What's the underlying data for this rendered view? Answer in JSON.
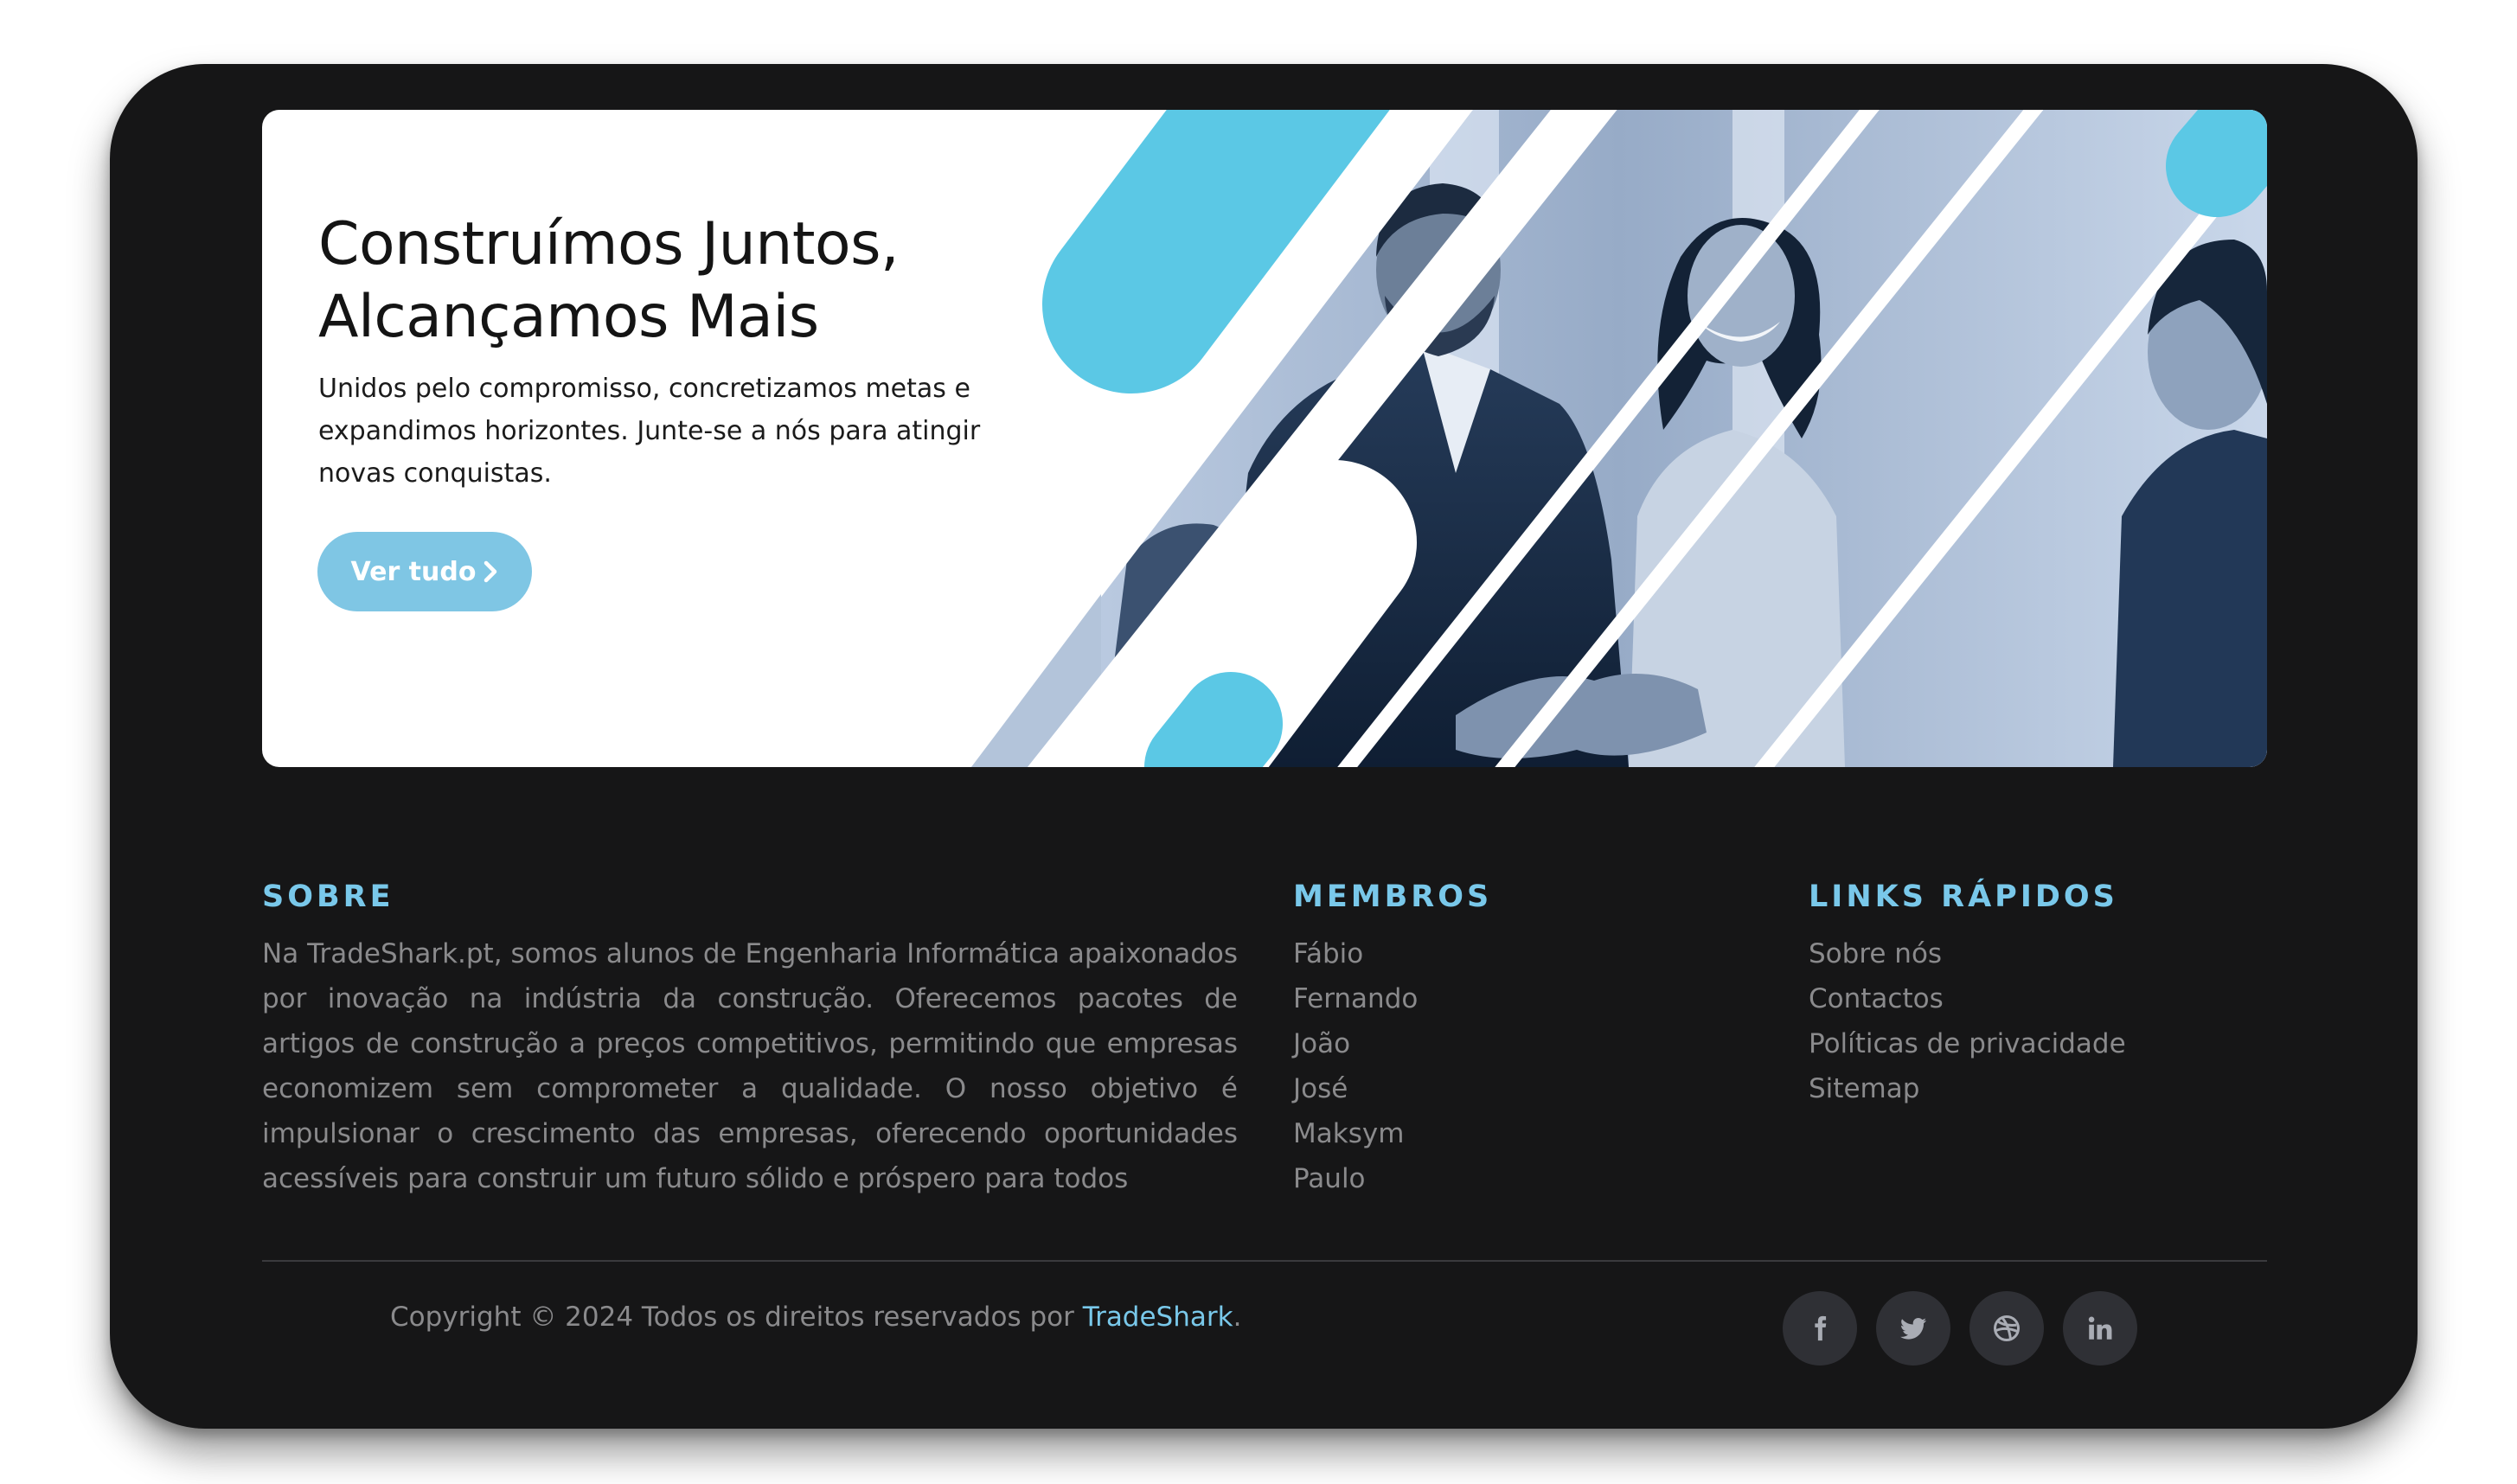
{
  "hero": {
    "title_line1": "Construímos Juntos,",
    "title_line2": "Alcançamos Mais",
    "description": "Unidos pelo compromisso, concretizamos metas e expandimos horizontes. Junte-se a nós para atingir novas conquistas.",
    "cta_label": "Ver tudo",
    "cta_icon": "chevron-right-icon",
    "accent_color": "#5bc8e5"
  },
  "footer": {
    "about": {
      "title": "SOBRE",
      "text": "Na TradeShark.pt, somos alunos de Engenharia Informática apaixonados por inovação na indústria da construção. Oferecemos pacotes de artigos de construção a preços competitivos, permitindo que empresas economizem sem comprometer a qualidade. O nosso objetivo é impulsionar o crescimento das empresas, oferecendo oportunidades acessíveis para construir um futuro sólido e próspero para todos"
    },
    "members": {
      "title": "MEMBROS",
      "items": [
        "Fábio",
        "Fernando",
        "João",
        "José",
        "Maksym",
        "Paulo"
      ]
    },
    "quick_links": {
      "title": "LINKS RÁPIDOS",
      "items": [
        "Sobre nós",
        "Contactos",
        "Políticas de privacidade",
        "Sitemap"
      ]
    },
    "copyright": {
      "prefix": "Copyright © 2024 Todos os direitos reservados por ",
      "brand": "TradeShark",
      "suffix": "."
    },
    "socials": [
      "facebook-icon",
      "twitter-icon",
      "dribbble-icon",
      "linkedin-icon"
    ],
    "heading_color": "#79c8ea",
    "background_color": "#161617"
  }
}
